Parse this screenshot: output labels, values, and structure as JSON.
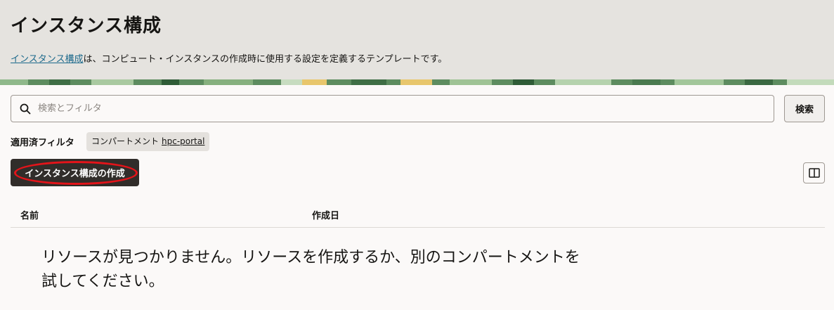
{
  "header": {
    "title": "インスタンス構成",
    "desc_link": "インスタンス構成",
    "desc_text": "は、コンピュート・インスタンスの作成時に使用する設定を定義するテンプレートです。"
  },
  "search": {
    "placeholder": "検索とフィルタ",
    "button_label": "検索"
  },
  "filters": {
    "label": "適用済フィルタ",
    "chips": [
      {
        "key": "コンパートメント",
        "value": "hpc-portal"
      }
    ]
  },
  "actions": {
    "create_label": "インスタンス構成の作成"
  },
  "table": {
    "columns": [
      "名前",
      "作成日"
    ],
    "empty_message": "リソースが見つかりません。リソースを作成するか、別のコンパートメントを試してください。"
  },
  "colors": {
    "header_bg": "#e5e3df",
    "primary_button": "#312d2a",
    "link": "#1d6a8c",
    "highlight": "#e3141a"
  },
  "icons": {
    "search": "search-icon",
    "columns": "columns-icon"
  }
}
